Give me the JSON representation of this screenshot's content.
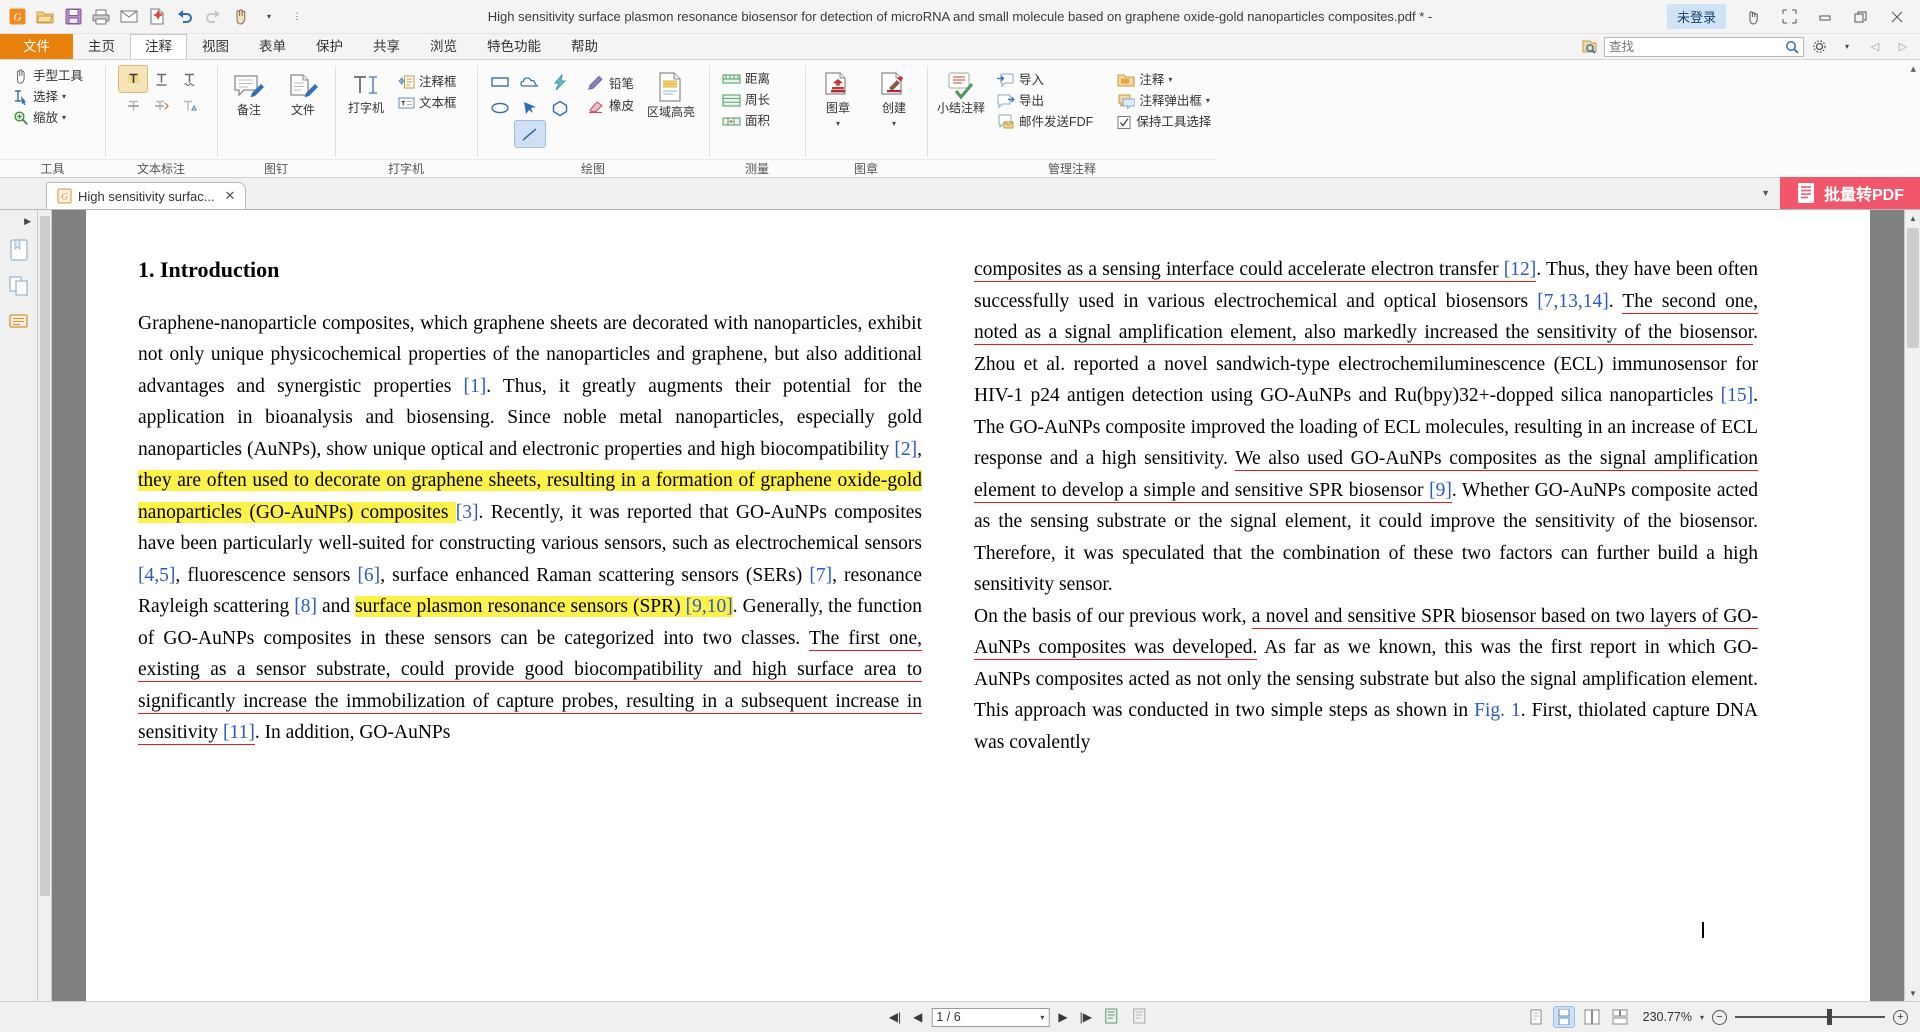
{
  "window": {
    "title": "High sensitivity surface plasmon resonance biosensor for detection of microRNA and small molecule based on graphene oxide-gold nanoparticles composites.pdf * -",
    "login_label": "未登录",
    "quick_access": [
      "app-logo-icon",
      "open-folder-icon",
      "save-icon",
      "print-icon",
      "email-icon",
      "new-doc-icon",
      "undo-icon",
      "redo-icon",
      "hand-tool-icon",
      "qat-dropdown-icon"
    ],
    "win_buttons": [
      "touch-mode-icon",
      "fullscreen-icon",
      "minimize-icon",
      "restore-icon",
      "close-icon"
    ]
  },
  "ribbon": {
    "tabs": [
      {
        "label": "文件",
        "id": "file",
        "active": false
      },
      {
        "label": "主页",
        "id": "home",
        "active": false
      },
      {
        "label": "注释",
        "id": "comment",
        "active": true
      },
      {
        "label": "视图",
        "id": "view",
        "active": false
      },
      {
        "label": "表单",
        "id": "form",
        "active": false
      },
      {
        "label": "保护",
        "id": "protect",
        "active": false
      },
      {
        "label": "共享",
        "id": "share",
        "active": false
      },
      {
        "label": "浏览",
        "id": "browse",
        "active": false
      },
      {
        "label": "特色功能",
        "id": "features",
        "active": false
      },
      {
        "label": "帮助",
        "id": "help",
        "active": false
      }
    ],
    "search": {
      "placeholder": "查找",
      "value": ""
    },
    "groups": [
      {
        "label": "工具",
        "items": [
          {
            "label": "手型工具",
            "icon": "hand-icon",
            "caret": false
          },
          {
            "label": "选择",
            "icon": "text-select-icon",
            "caret": true
          },
          {
            "label": "缩放",
            "icon": "zoom-icon",
            "caret": true
          }
        ]
      },
      {
        "label": "文本标注",
        "items": [
          {
            "label": "",
            "icon": "highlight-icon",
            "caret": false
          },
          {
            "label": "",
            "icon": "underline-text-icon",
            "caret": false
          },
          {
            "label": "",
            "icon": "squiggly-text-icon",
            "caret": false
          },
          {
            "label": "",
            "icon": "strikeout-icon",
            "caret": false
          },
          {
            "label": "",
            "icon": "replace-text-icon",
            "caret": false
          },
          {
            "label": "",
            "icon": "insert-text-icon",
            "caret": false
          }
        ]
      },
      {
        "label": "图钉",
        "items": [
          {
            "label": "备注",
            "icon": "note-pin-icon",
            "caret": false
          },
          {
            "label": "文件",
            "icon": "file-pin-icon",
            "caret": false
          }
        ]
      },
      {
        "label": "打字机",
        "items": [
          {
            "label": "打字机",
            "icon": "typewriter-icon",
            "caret": false
          },
          {
            "label": "注释框",
            "icon": "callout-box-icon",
            "caret": false
          },
          {
            "label": "文本框",
            "icon": "text-box-icon",
            "caret": false
          }
        ]
      },
      {
        "label": "绘图",
        "items": [
          {
            "label": "",
            "icon": "rectangle-icon",
            "caret": false
          },
          {
            "label": "",
            "icon": "cloud-shape-icon",
            "caret": false
          },
          {
            "label": "",
            "icon": "polyline-icon",
            "caret": false
          },
          {
            "label": "",
            "icon": "ellipse-icon",
            "caret": false
          },
          {
            "label": "",
            "icon": "arrow-icon",
            "caret": false
          },
          {
            "label": "",
            "icon": "polygon-icon",
            "caret": false
          },
          {
            "label": "",
            "icon": "line-icon",
            "caret": false
          },
          {
            "label": "铅笔",
            "icon": "pencil-icon",
            "caret": false
          },
          {
            "label": "橡皮",
            "icon": "eraser-icon",
            "caret": false
          },
          {
            "label": "区域高亮",
            "icon": "area-highlight-icon",
            "caret": false
          }
        ]
      },
      {
        "label": "测量",
        "items": [
          {
            "label": "距离",
            "icon": "distance-icon",
            "caret": false
          },
          {
            "label": "周长",
            "icon": "perimeter-icon",
            "caret": false
          },
          {
            "label": "面积",
            "icon": "area-icon",
            "caret": false
          }
        ]
      },
      {
        "label": "图章",
        "items": [
          {
            "label": "图章",
            "icon": "stamp-icon",
            "caret": true
          },
          {
            "label": "创建",
            "icon": "create-stamp-icon",
            "caret": true
          }
        ]
      },
      {
        "label": "管理注释",
        "items": [
          {
            "label": "小结注释",
            "icon": "summarize-comments-icon",
            "caret": false
          },
          {
            "label": "导入",
            "icon": "import-icon",
            "caret": false
          },
          {
            "label": "导出",
            "icon": "export-icon",
            "caret": false
          },
          {
            "label": "邮件发送FDF",
            "icon": "mail-fdf-icon",
            "caret": false
          },
          {
            "label": "注释",
            "icon": "comment-folder-icon",
            "caret": true
          },
          {
            "label": "注释弹出框",
            "icon": "comment-popup-icon",
            "caret": true
          },
          {
            "label": "保持工具选择",
            "icon": "checkbox-icon",
            "caret": false
          }
        ]
      }
    ]
  },
  "doc_tabs": {
    "tabs": [
      {
        "label": "High sensitivity surfac...",
        "close": "✕"
      }
    ],
    "batch_button": "批量转PDF"
  },
  "document": {
    "left_column": {
      "heading": "1. Introduction",
      "paragraph_runs": [
        {
          "t": "Graphene-nanoparticle composites, which graphene sheets are decorated with nanoparticles, exhibit not only unique physicochemical properties of the nanoparticles and graphene, but also additional advantages and synergistic properties ",
          "s": "plain"
        },
        {
          "t": "[1]",
          "s": "ref"
        },
        {
          "t": ". Thus, it greatly augments their potential for the application in bioanalysis and biosensing. Since noble metal nanoparticles, especially gold nanoparticles (AuNPs), show unique optical and electronic properties and high biocompatibility ",
          "s": "plain"
        },
        {
          "t": "[2]",
          "s": "ref"
        },
        {
          "t": ", ",
          "s": "plain"
        },
        {
          "t": "they are often used to decorate on graphene sheets, resulting in a formation of graphene oxide-gold nanoparticles (GO-AuNPs) composites ",
          "s": "hl"
        },
        {
          "t": "[3]",
          "s": "ref"
        },
        {
          "t": ". Recently, it was reported that GO-AuNPs composites have been particularly well-suited for constructing various sensors, such as electrochemical sensors ",
          "s": "plain"
        },
        {
          "t": "[4,5]",
          "s": "ref"
        },
        {
          "t": ", fluorescence sensors ",
          "s": "plain"
        },
        {
          "t": "[6]",
          "s": "ref"
        },
        {
          "t": ", surface enhanced Raman scattering sensors (SERs) ",
          "s": "plain"
        },
        {
          "t": "[7]",
          "s": "ref"
        },
        {
          "t": ", resonance Rayleigh scattering ",
          "s": "plain"
        },
        {
          "t": "[8]",
          "s": "ref"
        },
        {
          "t": " and ",
          "s": "plain"
        },
        {
          "t": "surface plasmon resonance sensors (SPR) ",
          "s": "hl"
        },
        {
          "t": "[9,10]",
          "s": "hlref"
        },
        {
          "t": ". Generally, the function of GO-AuNPs composites in these sensors can be categorized into two classes. ",
          "s": "plain"
        },
        {
          "t": "The first one, existing as a sensor substrate, could provide good biocompatibility and high surface area to significantly increase the immobilization of capture probes, resulting in a subsequent increase in sensitivity ",
          "s": "ulred"
        },
        {
          "t": "[11]",
          "s": "ulredref"
        },
        {
          "t": ". In addition, GO-AuNPs",
          "s": "plain"
        }
      ]
    },
    "right_column": {
      "paragraph_runs": [
        {
          "t": "composites as a sensing interface could accelerate electron transfer ",
          "s": "ulred"
        },
        {
          "t": "[12]",
          "s": "ulredref"
        },
        {
          "t": ". Thus, they have been often successfully used in various electrochemical and optical biosensors ",
          "s": "plain"
        },
        {
          "t": "[7,13,14]",
          "s": "ref"
        },
        {
          "t": ". ",
          "s": "plain"
        },
        {
          "t": "The second one, noted as a signal amplification element, also markedly increased the sensitivity of the biosensor",
          "s": "ulred"
        },
        {
          "t": ". Zhou et al. reported a novel sandwich-type electrochemiluminescence (ECL) immunosensor for HIV-1 p24 antigen detection using GO-AuNPs and Ru(bpy)32+-dopped silica nanoparticles ",
          "s": "plain"
        },
        {
          "t": "[15]",
          "s": "ref"
        },
        {
          "t": ". The GO-AuNPs composite improved the loading of ECL molecules, resulting in an increase of ECL response and a high sensitivity. ",
          "s": "plain"
        },
        {
          "t": "We also used GO-AuNPs composites as the signal amplification element to develop a simple and sensitive SPR biosensor ",
          "s": "ulred"
        },
        {
          "t": "[9]",
          "s": "ulredref"
        },
        {
          "t": ". Whether GO-AuNPs composite acted as the sensing substrate or the signal element, it could improve the sensitivity of the biosensor. Therefore, it was speculated that the combination of these two factors can further build a high sensitivity sensor.",
          "s": "plain"
        }
      ],
      "paragraph2_runs": [
        {
          "t": "On the basis of our previous work, ",
          "s": "plain"
        },
        {
          "t": "a novel and sensitive SPR biosensor based on two layers of GO-AuNPs composites was developed.",
          "s": "ulred"
        },
        {
          "t": " As far as we known, this was the first report in which GO-AuNPs composites acted as not only the sensing substrate but also the signal amplification element. This approach was conducted in two simple steps as shown in ",
          "s": "plain"
        },
        {
          "t": "Fig. 1",
          "s": "ref"
        },
        {
          "t": ". First, thiolated capture DNA was covalently",
          "s": "plain"
        }
      ]
    }
  },
  "status_bar": {
    "page_value": "1 / 6",
    "zoom_value": "230.77%",
    "nav": [
      "first-page-icon",
      "prev-page-icon",
      "next-page-icon",
      "last-page-icon",
      "fit-page-icon",
      "snapshot-icon"
    ],
    "views": [
      "single-page-icon",
      "continuous-icon",
      "facing-icon",
      "continuous-facing-icon"
    ]
  },
  "colors": {
    "accent_orange": "#e8820c",
    "batch_red": "#f1566a",
    "highlight_yellow": "#fdf24a",
    "underline_red": "#e01b1b",
    "ref_blue": "#2b59c3"
  }
}
